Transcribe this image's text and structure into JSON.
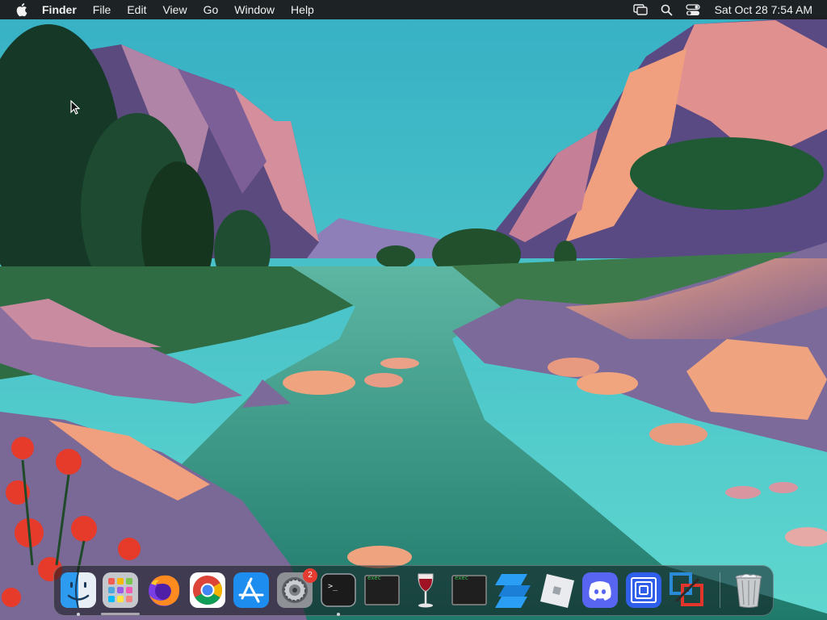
{
  "menubar": {
    "apple_icon": "apple-logo",
    "app_name": "Finder",
    "menus": [
      "File",
      "Edit",
      "View",
      "Go",
      "Window",
      "Help"
    ],
    "status_icons": [
      "screen-mirroring-icon",
      "spotlight-search-icon",
      "control-center-icon"
    ],
    "clock": "Sat Oct 28  7:54 AM"
  },
  "desktop": {
    "wallpaper": "macOS Monterey canyon river illustration"
  },
  "dock": {
    "apps": [
      {
        "name": "Finder",
        "icon": "finder-icon",
        "running": true
      },
      {
        "name": "Launchpad",
        "icon": "launchpad-icon",
        "running": false
      },
      {
        "name": "Firefox",
        "icon": "firefox-icon",
        "running": false
      },
      {
        "name": "Google Chrome",
        "icon": "chrome-icon",
        "running": false
      },
      {
        "name": "App Store",
        "icon": "app-store-icon",
        "running": false
      },
      {
        "name": "System Preferences",
        "icon": "system-preferences-icon",
        "running": false,
        "badge": "2"
      },
      {
        "name": "Terminal",
        "icon": "terminal-icon",
        "running": true
      },
      {
        "name": "exec",
        "icon": "exec-icon",
        "running": false
      },
      {
        "name": "Wine",
        "icon": "wine-icon",
        "running": false
      },
      {
        "name": "exec",
        "icon": "exec-icon",
        "running": false
      },
      {
        "name": "Stack",
        "icon": "stack-icon",
        "running": false
      },
      {
        "name": "Roblox",
        "icon": "roblox-icon",
        "running": false
      },
      {
        "name": "Discord",
        "icon": "discord-icon",
        "running": false
      },
      {
        "name": "Spiral App",
        "icon": "spiral-app-icon",
        "running": false
      },
      {
        "name": "Parallels",
        "icon": "parallels-icon",
        "running": false
      },
      {
        "name": "Trash",
        "icon": "trash-icon",
        "running": false
      }
    ],
    "exec_label": "exec",
    "terminal_prompt": ">_"
  },
  "colors": {
    "sky": "#3fc1c6",
    "river": "#3fa692",
    "menubar": "#1c1c1e",
    "accent_rock": "#f2a176",
    "badge": "#e53b30"
  }
}
